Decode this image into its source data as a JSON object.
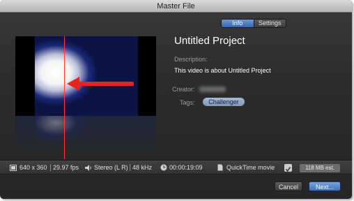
{
  "window": {
    "title": "Master File"
  },
  "tabs": {
    "info": "Info",
    "settings": "Settings",
    "active": "Info"
  },
  "project": {
    "title": "Untitled Project",
    "description_label": "Description:",
    "description": "This video is about Untitled Project",
    "creator_label": "Creator:",
    "creator_value_redacted": true,
    "tags_label": "Tags:",
    "tags": [
      "Challenger"
    ]
  },
  "info_bar": {
    "resolution": "640 x 360",
    "fps": "29.97 fps",
    "audio_channels": "Stereo (L R)",
    "sample_rate": "48 kHz",
    "duration": "00:00:19:09",
    "format": "QuickTime movie",
    "size": "118 MB est."
  },
  "buttons": {
    "cancel": "Cancel",
    "next": "Next..."
  },
  "icons": {
    "video": "film-icon",
    "audio": "speaker-icon",
    "duration": "clock-icon",
    "format": "document-icon",
    "option": "checkbox-icon"
  },
  "colors": {
    "accent_blue": "#3565b0",
    "playhead": "#ff3b3b",
    "tag_token": "#8ea4c4"
  }
}
